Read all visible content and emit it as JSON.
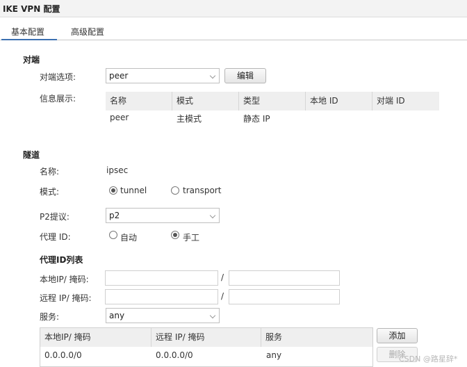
{
  "window": {
    "title": "IKE VPN 配置"
  },
  "tabs": [
    {
      "label": "基本配置",
      "active": true
    },
    {
      "label": "高级配置",
      "active": false
    }
  ],
  "peer_section": {
    "title": "对端",
    "option_label": "对端选项:",
    "option_value": "peer",
    "edit_button": "编辑",
    "info_label": "信息展示:",
    "table_headers": [
      "名称",
      "模式",
      "类型",
      "本地 ID",
      "对端 ID"
    ],
    "table_row": [
      "peer",
      "主模式",
      "静态 IP",
      "",
      ""
    ]
  },
  "tunnel_section": {
    "title": "隧道",
    "name_label": "名称:",
    "name_value": "ipsec",
    "mode_label": "模式:",
    "mode_options": [
      {
        "label": "tunnel",
        "checked": true
      },
      {
        "label": "transport",
        "checked": false
      }
    ],
    "p2_label": "P2提议:",
    "p2_value": "p2",
    "proxy_id_label": "代理 ID:",
    "proxy_options": [
      {
        "label": "自动",
        "checked": false
      },
      {
        "label": "手工",
        "checked": true
      }
    ]
  },
  "proxy_list": {
    "title": "代理ID列表",
    "local_label": "本地IP/ 掩码:",
    "remote_label": "远程 IP/ 掩码:",
    "separator": "/",
    "service_label": "服务:",
    "service_value": "any",
    "table_headers": [
      "本地IP/ 掩码",
      "远程 IP/ 掩码",
      "服务"
    ],
    "table_row": [
      "0.0.0.0/0",
      "0.0.0.0/0",
      "any"
    ],
    "add_button": "添加",
    "delete_button": "删除"
  },
  "watermark": "CSDN @路星辞*"
}
